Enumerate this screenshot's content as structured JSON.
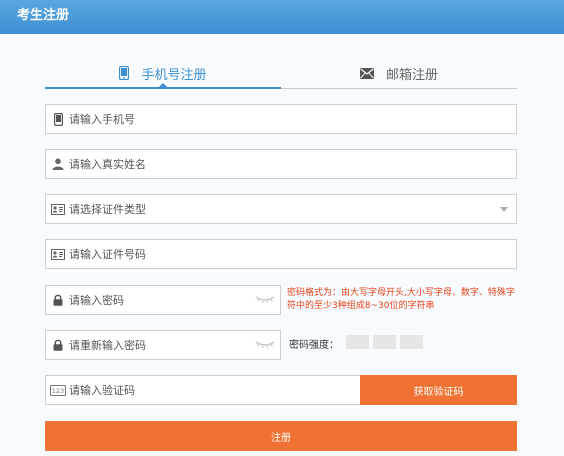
{
  "header": {
    "title": "考生注册"
  },
  "tabs": [
    {
      "label": "手机号注册",
      "icon": "phone-icon",
      "active": true
    },
    {
      "label": "邮箱注册",
      "icon": "envelope-icon",
      "active": false
    }
  ],
  "form": {
    "phone": {
      "placeholder": "请输入手机号",
      "icon": "phone-icon"
    },
    "name": {
      "placeholder": "请输入真实姓名",
      "icon": "user-icon"
    },
    "id_type": {
      "placeholder": "请选择证件类型",
      "icon": "id-card-icon"
    },
    "id_number": {
      "placeholder": "请输入证件号码",
      "icon": "id-card-icon"
    },
    "password": {
      "placeholder": "请输入密码",
      "icon": "lock-icon"
    },
    "password_confirm": {
      "placeholder": "请重新输入密码",
      "icon": "lock-icon"
    },
    "captcha": {
      "placeholder": "请输入验证码",
      "icon": "code-123-icon"
    }
  },
  "password_hint": "密码格式为：由大写字母开头,大小写字母、数字、特殊字符中的至少3种组成8~30位的字符串",
  "strength": {
    "label": "密码强度：",
    "levels": 3
  },
  "buttons": {
    "get_code": "获取验证码",
    "register": "注册"
  },
  "colors": {
    "header": "#3d8fd2",
    "accent": "#3d8fd2",
    "button": "#f07232",
    "hint": "#e8431a"
  }
}
